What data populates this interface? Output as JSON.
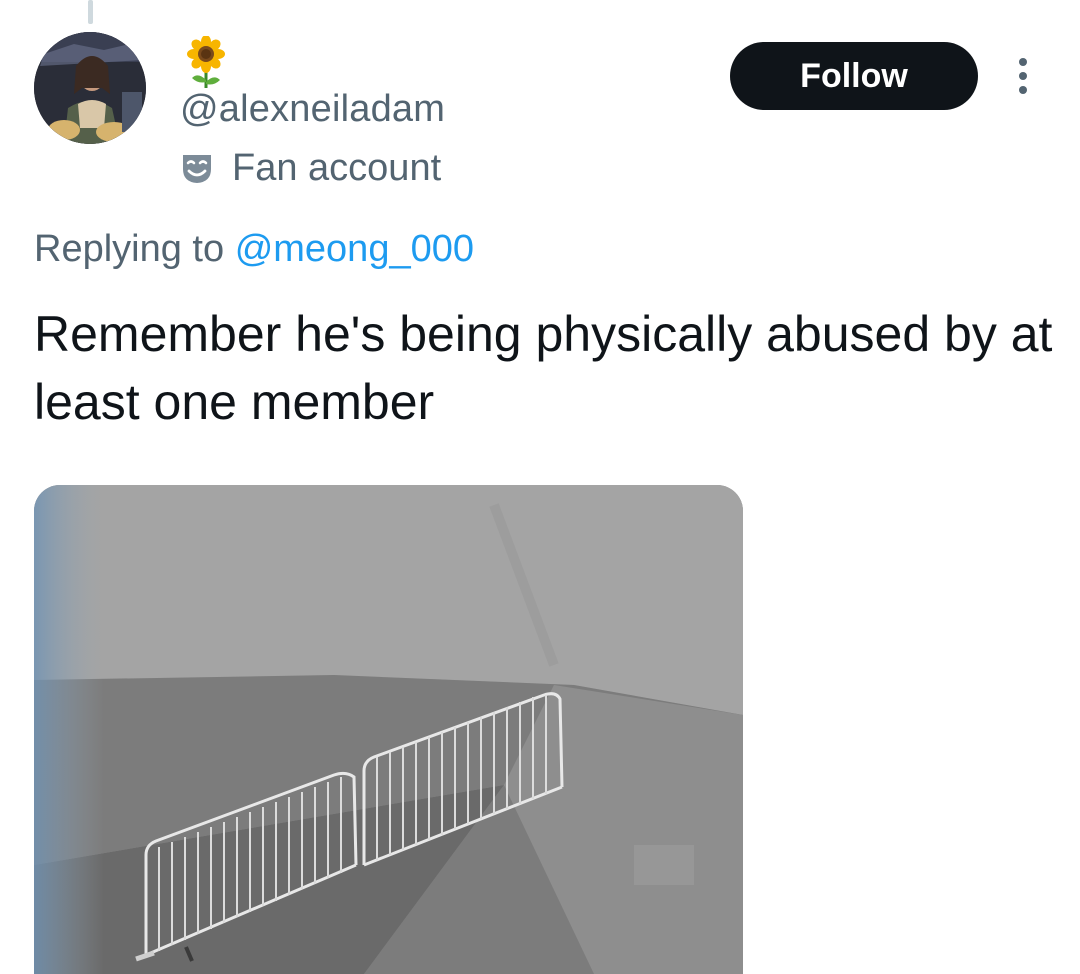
{
  "tweet": {
    "author": {
      "display_name_emoji": "🌻",
      "handle": "@alexneiladam",
      "label_icon": "theater-mask-icon",
      "label_text": "Fan account"
    },
    "follow_label": "Follow",
    "more_icon": "more-vertical-icon",
    "reply": {
      "prefix": "Replying to",
      "user": "@meong_000"
    },
    "text": "Remember he's being physically abused by at least one member",
    "media": {
      "type": "video-frame",
      "description_icon": "photo-media"
    }
  },
  "colors": {
    "text_primary": "#0f1419",
    "text_secondary": "#536471",
    "link": "#1d9bf0",
    "button_bg": "#0f1419",
    "button_text": "#ffffff"
  }
}
